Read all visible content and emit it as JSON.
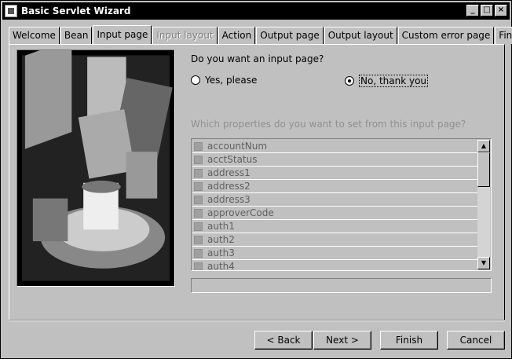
{
  "window": {
    "title": "Basic Servlet Wizard",
    "buttons": {
      "minimize": "_",
      "maximize": "□",
      "close": "×"
    }
  },
  "tabs": [
    {
      "label": "Welcome",
      "state": "normal"
    },
    {
      "label": "Bean",
      "state": "normal"
    },
    {
      "label": "Input page",
      "state": "active"
    },
    {
      "label": "Input layout",
      "state": "disabled"
    },
    {
      "label": "Action",
      "state": "normal"
    },
    {
      "label": "Output page",
      "state": "normal"
    },
    {
      "label": "Output layout",
      "state": "normal"
    },
    {
      "label": "Custom error page",
      "state": "normal"
    },
    {
      "label": "Finish",
      "state": "normal"
    }
  ],
  "main": {
    "question": "Do you want an input page?",
    "radio_yes": "Yes, please",
    "radio_no": "No, thank you",
    "selected_option": "No, thank you",
    "properties_label": "Which properties do you want to set from this input page?",
    "properties": [
      "accountNum",
      "acctStatus",
      "address1",
      "address2",
      "address3",
      "approverCode",
      "auth1",
      "auth2",
      "auth3",
      "auth4"
    ],
    "status_text": ""
  },
  "footer": {
    "back": "< Back",
    "next": "Next >",
    "finish": "Finish",
    "cancel": "Cancel"
  },
  "colors": {
    "face": "#c0c0c0",
    "title_bar": "#000000",
    "disabled_text": "#909090"
  }
}
